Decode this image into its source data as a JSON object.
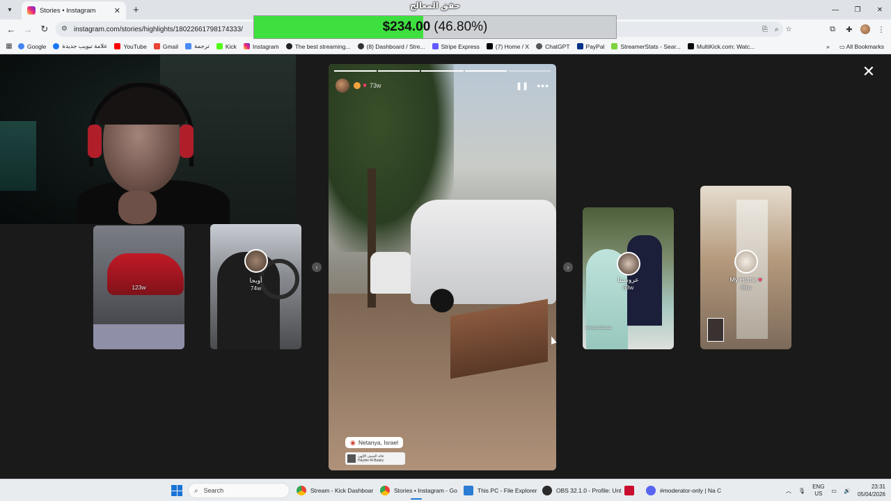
{
  "browser": {
    "tab_title": "Stories • Instagram",
    "url": "instagram.com/stories/highlights/18022661798174333/",
    "bookmarks": [
      "Google",
      "علامة تبويب جديدة",
      "YouTube",
      "Gmail",
      "ترجمة",
      "Kick",
      "Instagram",
      "The best streaming...",
      "(8) Dashboard / Stre...",
      "Stripe Express",
      "(7) Home / X",
      "ChatGPT",
      "PayPal",
      "StreamerStats - Sear...",
      "MultiKick.com: Watc..."
    ],
    "all_bookmarks": "All Bookmarks"
  },
  "goal": {
    "title": "حقق المعالج",
    "amount": "$234.00",
    "percent_text": "(46.80%)",
    "progress": 0.468,
    "fill_color": "#3ee03f"
  },
  "story": {
    "age": "73w",
    "location": "Netanya, Israel",
    "mention_name": "قائد الجيش الإلهي",
    "mention_sub": "Hayder Al Baqiry",
    "progress_total": 5,
    "progress_done": 4
  },
  "highlights": [
    {
      "label": "",
      "age": "123w"
    },
    {
      "label": "أوبحا",
      "age": "74w"
    },
    {
      "label": "عروستنا",
      "age": "83w",
      "overlay_text": "#mona.kassar"
    },
    {
      "label": "My Home",
      "age": "98w"
    }
  ],
  "taskbar": {
    "search_placeholder": "Search",
    "apps": [
      "Stream - Kick Dashboar",
      "Stories • Instagram - Go",
      "This PC - File Explorer",
      "OBS 32.1.0 - Profile: Unt",
      "#moderator-only | Na C"
    ],
    "lang_top": "ENG",
    "lang_bottom": "US",
    "time": "23:31",
    "date": "05/04/2026"
  }
}
